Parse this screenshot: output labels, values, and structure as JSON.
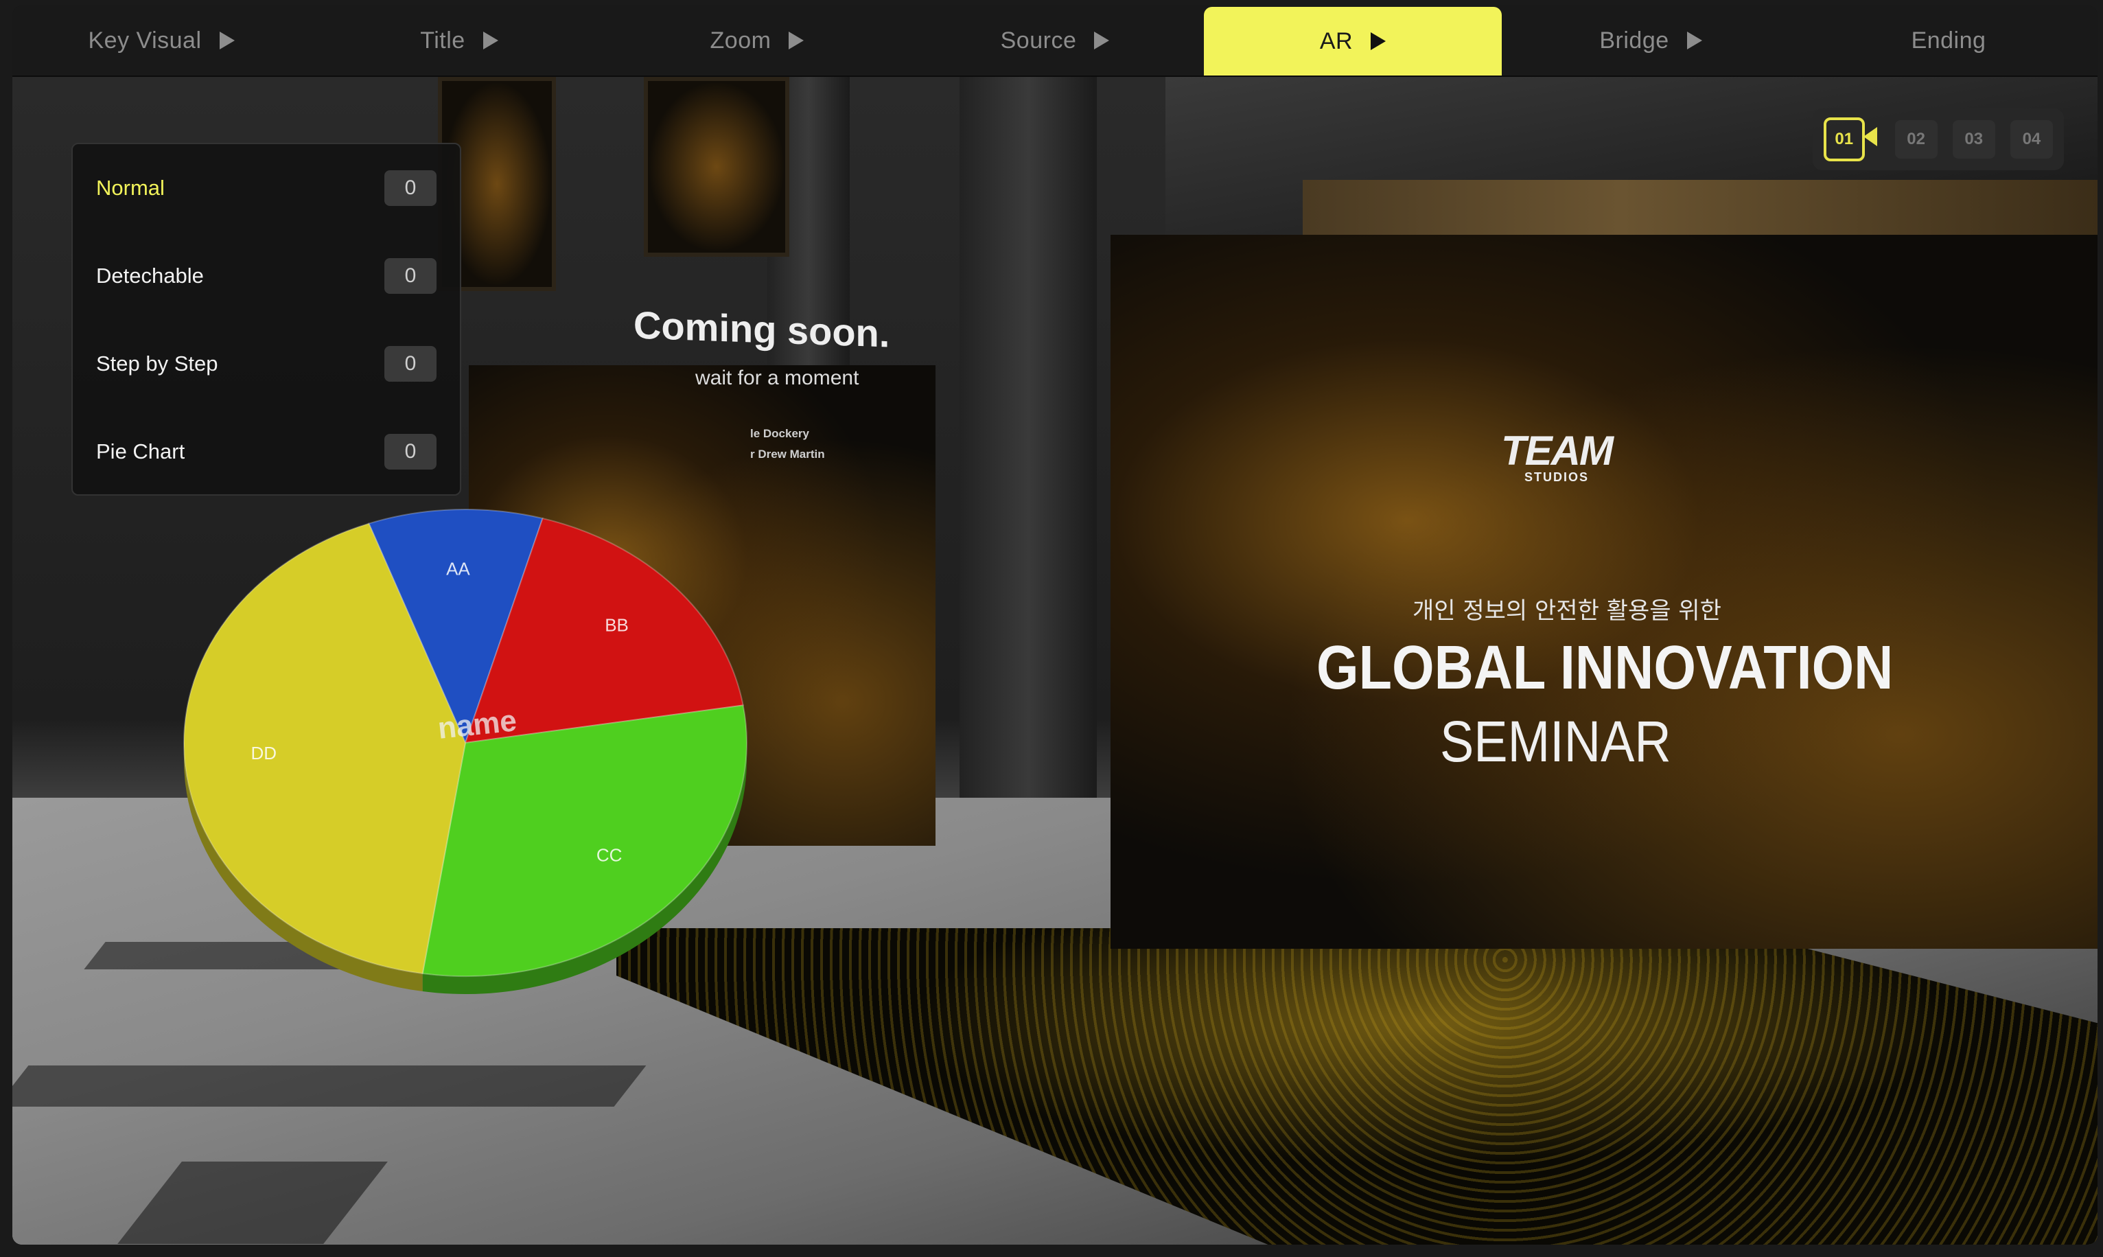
{
  "tabs": [
    {
      "label": "Key Visual",
      "arrow": true
    },
    {
      "label": "Title",
      "arrow": true
    },
    {
      "label": "Zoom",
      "arrow": true
    },
    {
      "label": "Source",
      "arrow": true
    },
    {
      "label": "AR",
      "arrow": true,
      "active": true
    },
    {
      "label": "Bridge",
      "arrow": true
    },
    {
      "label": "Ending",
      "arrow": false
    }
  ],
  "menu": {
    "items": [
      {
        "label": "Normal",
        "count": "0",
        "active": true
      },
      {
        "label": "Detechable",
        "count": "0"
      },
      {
        "label": "Step by Step",
        "count": "0"
      },
      {
        "label": "Pie Chart",
        "count": "0"
      }
    ]
  },
  "camera": {
    "buttons": [
      "01",
      "02",
      "03",
      "04"
    ],
    "active": "01"
  },
  "scene": {
    "coming_soon": {
      "title": "Coming soon.",
      "subtitle": "wait for a moment",
      "credits": [
        "le Dockery",
        "r Drew Martin"
      ]
    },
    "seminar": {
      "logo": "TEAM",
      "logo_sub": "STUDIOS",
      "korean": "개인 정보의 안전한 활용을 위한",
      "title": "GLOBAL INNOVATION",
      "subtitle": "SEMINAR"
    }
  },
  "chart_data": {
    "type": "pie",
    "title": "name",
    "slices": [
      {
        "label": "AA",
        "value": 10,
        "color": "#1f4fc2"
      },
      {
        "label": "BB",
        "value": 18,
        "color": "#d11212"
      },
      {
        "label": "CC",
        "value": 30,
        "color": "#4fcf1f"
      },
      {
        "label": "DD",
        "value": 42,
        "color": "#d6cd28"
      }
    ]
  },
  "colors": {
    "accent": "#f2f35a",
    "tab_text": "#8d8d8d",
    "panel_bg": "#121212"
  }
}
